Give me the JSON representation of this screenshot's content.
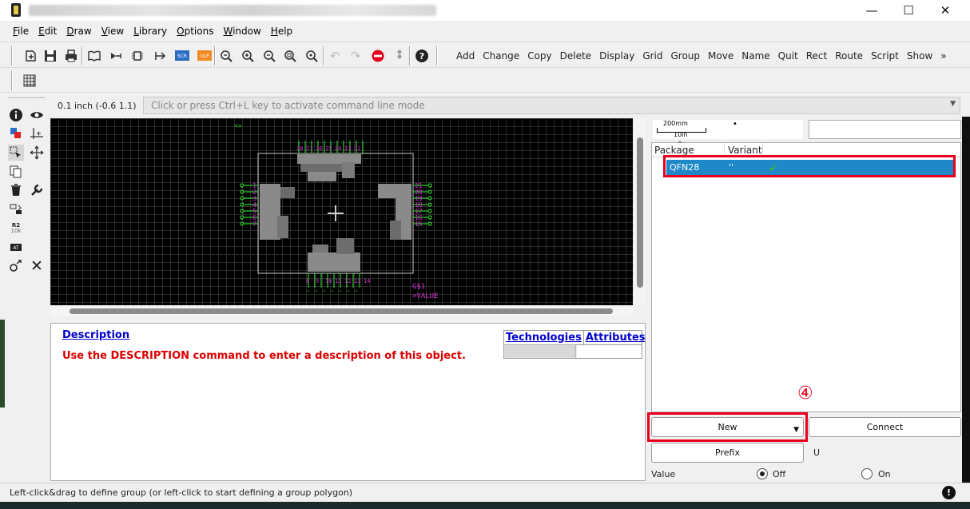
{
  "window": {
    "minimize_glyph": "—",
    "maximize_glyph": "☐",
    "close_glyph": "✕"
  },
  "menu": [
    {
      "key": "F",
      "rest": "ile"
    },
    {
      "key": "E",
      "rest": "dit"
    },
    {
      "key": "D",
      "rest": "raw"
    },
    {
      "key": "V",
      "rest": "iew"
    },
    {
      "key": "L",
      "rest": "ibrary"
    },
    {
      "key": "O",
      "rest": "ptions"
    },
    {
      "key": "W",
      "rest": "indow"
    },
    {
      "key": "H",
      "rest": "elp"
    }
  ],
  "toolbar": {
    "commands": [
      "Add",
      "Change",
      "Copy",
      "Delete",
      "Display",
      "Grid",
      "Group",
      "Move",
      "Name",
      "Quit",
      "Rect",
      "Route",
      "Script",
      "Show"
    ],
    "overflow": "»",
    "scr_label": "SCR",
    "ulp_label": "ULP"
  },
  "command_line": {
    "coordinates": "0.1 inch (-0.6 1.1)",
    "placeholder": "Click or press Ctrl+L key to activate command line mode"
  },
  "canvas": {
    "gate_name": "G$1",
    "value_label": ">VALUE",
    "pins_left": [
      "1",
      "2",
      "3",
      "4",
      "5",
      "6",
      "7"
    ],
    "pins_right": [
      "21",
      "20",
      "19",
      "18",
      "17",
      "16",
      "15"
    ],
    "pins_top": [
      "28",
      "27",
      "26",
      "25",
      "24",
      "23",
      "22"
    ],
    "pins_bottom": [
      "8",
      "9",
      "10",
      "11",
      "12",
      "13",
      "14"
    ]
  },
  "description": {
    "title": "Description",
    "text": "Use the DESCRIPTION command to enter a description of this object."
  },
  "tech_table": {
    "technologies_label": "Technologies",
    "attributes_label": "Attributes"
  },
  "right_panel": {
    "scale_top": "200mm",
    "scale_bottom": "10in",
    "columns": {
      "package": "Package",
      "variant": "Variant"
    },
    "package_row": {
      "package": "QFN28",
      "variant": "''"
    },
    "annotation_number": "④",
    "new_button": "New",
    "connect_button": "Connect",
    "prefix_button": "Prefix",
    "prefix_value": "U",
    "value_label": "Value",
    "off_label": "Off",
    "on_label": "On"
  },
  "status": {
    "text": "Left-click&drag to define group (or left-click to start defining a group polygon)",
    "icon": "!"
  },
  "colors": {
    "selection": "#1e88c8",
    "annotation_red": "#e8001c",
    "pin_green": "#2ecc2e",
    "pin_magenta": "#d633d6",
    "link_blue": "#0000cc",
    "desc_red": "#dd0000"
  }
}
